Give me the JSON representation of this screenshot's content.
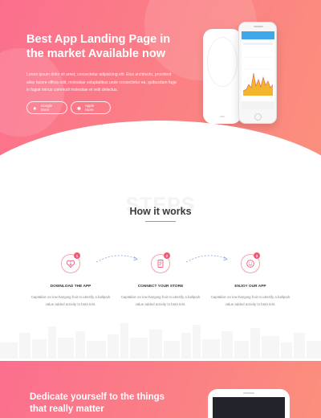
{
  "hero": {
    "title": "Best App Landing Page in the market Available now",
    "description": "Lorem ipsum dolor sit amet, consectetur adipisicing elit. Eius architecto, provident alias facere officia odit, molestiae voluptatibus unde consectetur ea, quibusdam fuga in fugiat minus commodi molestiae et velit delectus.",
    "buttons": [
      {
        "label": "Google Store",
        "icon": "android-icon"
      },
      {
        "label": "Apple Store",
        "icon": "apple-icon"
      }
    ]
  },
  "steps_section": {
    "background_word": "STEPS",
    "title": "How it works",
    "steps": [
      {
        "number": "1",
        "title": "DOWNLOAD THE APP",
        "icon": "download-heart-icon",
        "description": "Capitalise on low hanging fruit to identify a ballpark value added activity to beta test."
      },
      {
        "number": "2",
        "title": "CONNECT YOUR STORE",
        "icon": "document-icon",
        "description": "Capitalise on low hanging fruit to identify a ballpark value added activity to beta test."
      },
      {
        "number": "3",
        "title": "ENJOY OUR APP",
        "icon": "smiley-icon",
        "description": "Capitalise on low hanging fruit to identify a ballpark value added activity to beta test."
      }
    ]
  },
  "cta": {
    "title": "Dedicate yourself to the things that really matter"
  },
  "colors": {
    "accent": "#f45a74",
    "hero_gradient_start": "#fb6f8e",
    "hero_gradient_end": "#fb8f7c"
  }
}
